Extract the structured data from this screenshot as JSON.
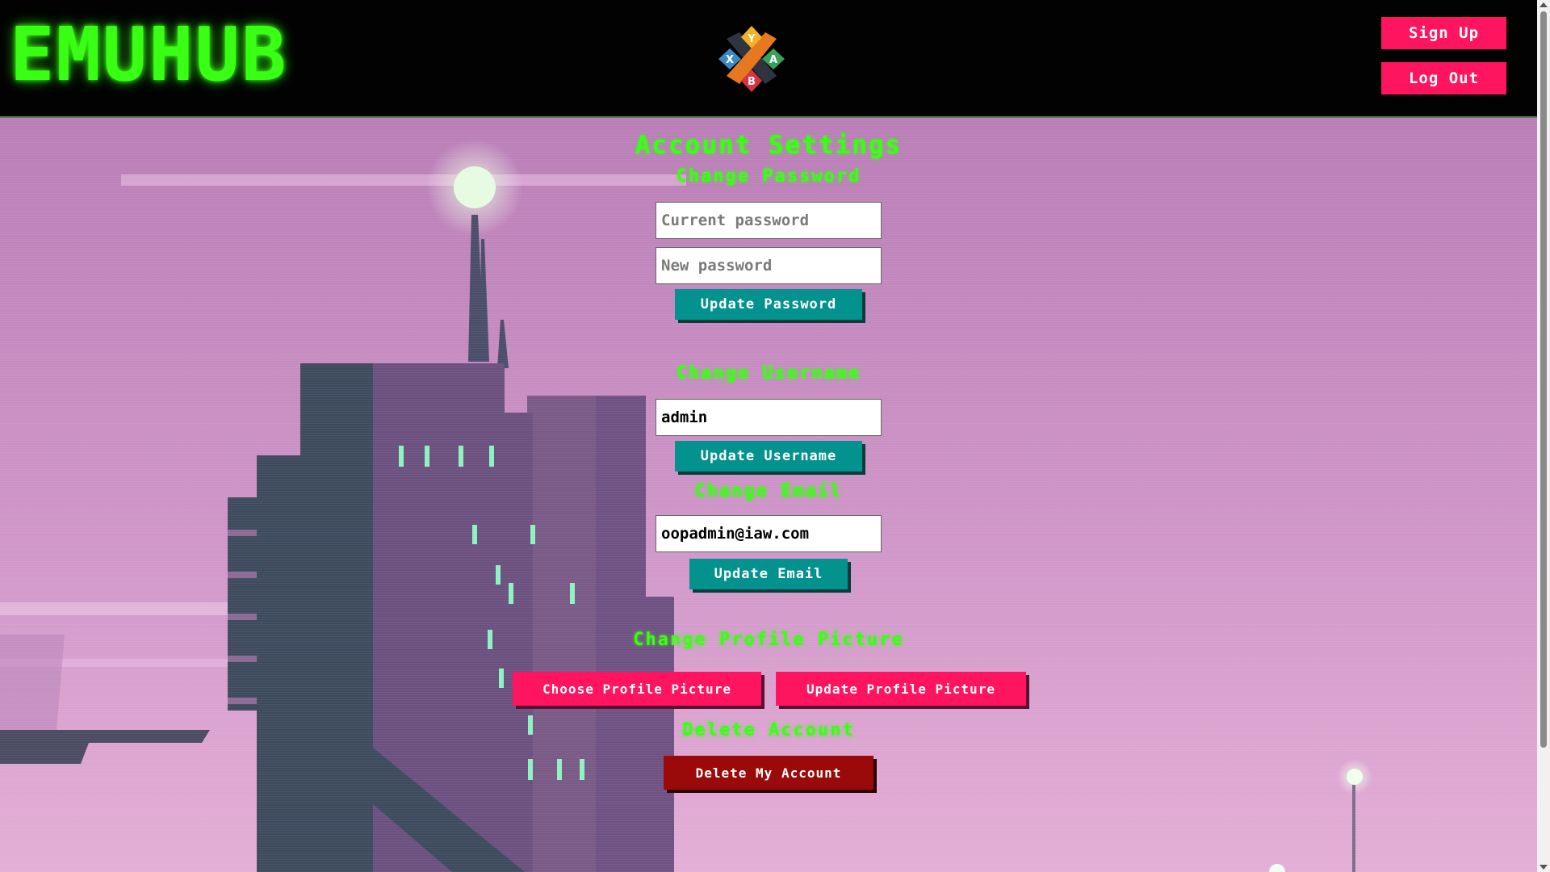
{
  "header": {
    "logo_text": "EMUHUB",
    "emblem_icon": "gamepad-buttons-icon",
    "emblem_letters": {
      "top": "Y",
      "left": "X",
      "right": "A",
      "bottom": "B"
    },
    "signup_label": "Sign Up",
    "logout_label": "Log Out"
  },
  "settings": {
    "title": "Account Settings",
    "password": {
      "heading": "Change Password",
      "current_placeholder": "Current password",
      "new_placeholder": "New password",
      "button": "Update Password"
    },
    "username": {
      "heading": "Change Username",
      "value": "admin",
      "button": "Update Username"
    },
    "email": {
      "heading": "Change Email",
      "value": "oopadmin@iaw.com",
      "button": "Update Email"
    },
    "picture": {
      "heading": "Change Profile Picture",
      "choose_button": "Choose Profile Picture",
      "update_button": "Update Profile Picture"
    },
    "delete": {
      "heading": "Delete Account",
      "button": "Delete My Account"
    }
  },
  "colors": {
    "logo_green": "#39ff14",
    "pink_accent": "#ff1460",
    "teal_button": "#04928f",
    "danger_red": "#9b0a0a",
    "background_pink": "#c58ac0"
  }
}
